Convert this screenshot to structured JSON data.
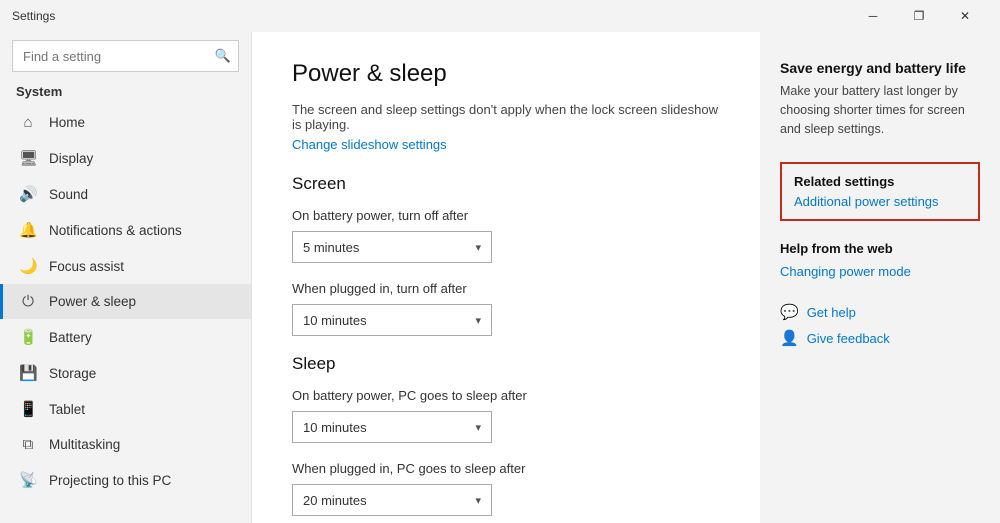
{
  "titleBar": {
    "title": "Settings",
    "minimizeLabel": "─",
    "restoreLabel": "❐",
    "closeLabel": "✕"
  },
  "sidebar": {
    "searchPlaceholder": "Find a setting",
    "sectionLabel": "System",
    "items": [
      {
        "id": "home",
        "icon": "⌂",
        "label": "Home"
      },
      {
        "id": "display",
        "icon": "🖥",
        "label": "Display"
      },
      {
        "id": "sound",
        "icon": "🔊",
        "label": "Sound"
      },
      {
        "id": "notifications",
        "icon": "🔔",
        "label": "Notifications & actions"
      },
      {
        "id": "focus-assist",
        "icon": "🌙",
        "label": "Focus assist"
      },
      {
        "id": "power-sleep",
        "icon": "⏻",
        "label": "Power & sleep",
        "active": true
      },
      {
        "id": "battery",
        "icon": "🔋",
        "label": "Battery"
      },
      {
        "id": "storage",
        "icon": "💾",
        "label": "Storage"
      },
      {
        "id": "tablet",
        "icon": "📱",
        "label": "Tablet"
      },
      {
        "id": "multitasking",
        "icon": "⧉",
        "label": "Multitasking"
      },
      {
        "id": "projecting",
        "icon": "📡",
        "label": "Projecting to this PC"
      }
    ]
  },
  "main": {
    "pageTitle": "Power & sleep",
    "description": "The screen and sleep settings don't apply when the lock screen slideshow is playing.",
    "changeSlideshow": "Change slideshow settings",
    "screenSection": {
      "title": "Screen",
      "batteryLabel": "On battery power, turn off after",
      "batteryValue": "5 minutes",
      "pluggedLabel": "When plugged in, turn off after",
      "pluggedValue": "10 minutes"
    },
    "sleepSection": {
      "title": "Sleep",
      "batteryLabel": "On battery power, PC goes to sleep after",
      "batteryValue": "10 minutes",
      "pluggedLabel": "When plugged in, PC goes to sleep after",
      "pluggedValue": "20 minutes"
    }
  },
  "rightPanel": {
    "saveEnergyTitle": "Save energy and battery life",
    "saveEnergyText": "Make your battery last longer by choosing shorter times for screen and sleep settings.",
    "relatedSettings": {
      "title": "Related settings",
      "link": "Additional power settings"
    },
    "helpTitle": "Help from the web",
    "helpLinks": [
      {
        "id": "get-help",
        "icon": "💬",
        "label": "Get help"
      },
      {
        "id": "give-feedback",
        "icon": "👤",
        "label": "Give feedback"
      }
    ],
    "changingPowerMode": "Changing power mode"
  }
}
